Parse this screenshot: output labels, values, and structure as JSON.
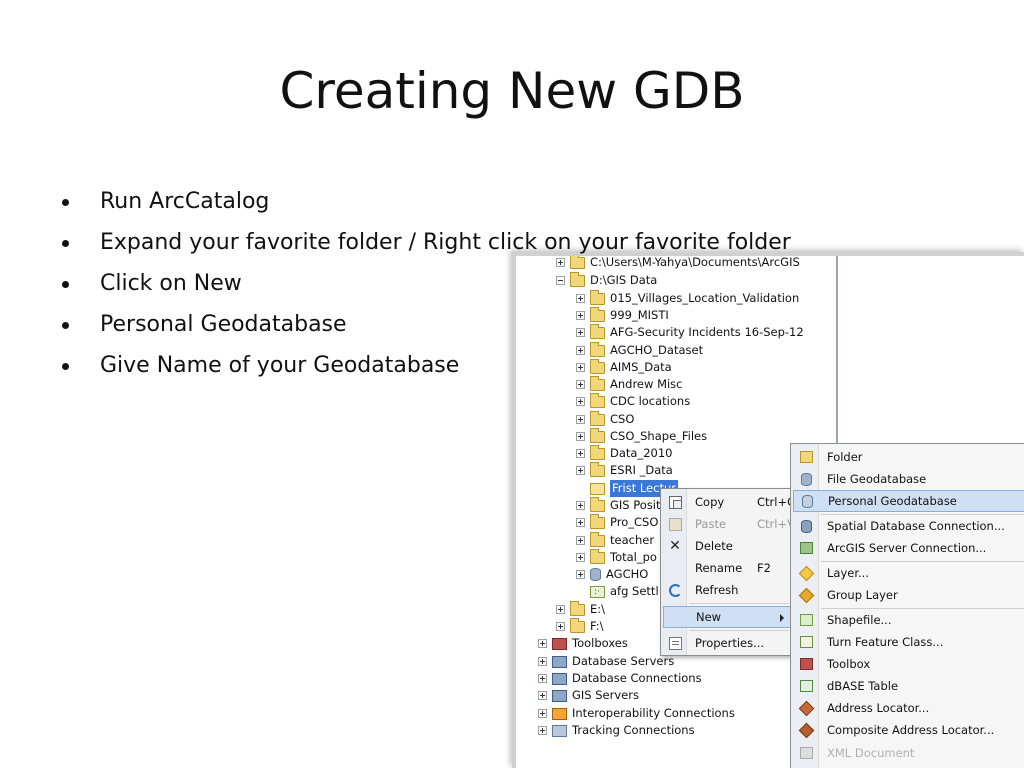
{
  "slide": {
    "title": "Creating New GDB",
    "bullets": [
      "Run ArcCatalog",
      "Expand your favorite folder / Right click on your favorite folder",
      "Click on New",
      "Personal Geodatabase",
      "Give Name of your Geodatabase"
    ]
  },
  "tree": {
    "items": [
      {
        "label": "C:\\Users\\M-Yahya\\Documents\\ArcGIS"
      },
      {
        "label": "D:\\GIS Data"
      },
      {
        "label": "015_Villages_Location_Validation"
      },
      {
        "label": "999_MISTI"
      },
      {
        "label": "AFG-Security Incidents 16-Sep-12"
      },
      {
        "label": "AGCHO_Dataset"
      },
      {
        "label": "AIMS_Data"
      },
      {
        "label": "Andrew Misc"
      },
      {
        "label": "CDC locations"
      },
      {
        "label": "CSO"
      },
      {
        "label": "CSO_Shape_Files"
      },
      {
        "label": "Data_2010"
      },
      {
        "label": "ESRI _Data"
      },
      {
        "label": "Frist Lectur"
      },
      {
        "label": "GIS Posit"
      },
      {
        "label": "Pro_CSO"
      },
      {
        "label": "teacher"
      },
      {
        "label": "Total_po"
      },
      {
        "label": "AGCHO"
      },
      {
        "label": "afg Settl"
      },
      {
        "label": "E:\\"
      },
      {
        "label": "F:\\"
      },
      {
        "label": "Toolboxes"
      },
      {
        "label": "Database Servers"
      },
      {
        "label": "Database Connections"
      },
      {
        "label": "GIS Servers"
      },
      {
        "label": "Interoperability Connections"
      },
      {
        "label": "Tracking Connections"
      }
    ]
  },
  "context_menu": {
    "items": [
      {
        "label": "Copy",
        "shortcut": "Ctrl+C",
        "icon": "copy-icon"
      },
      {
        "label": "Paste",
        "shortcut": "Ctrl+V",
        "icon": "paste-icon"
      },
      {
        "label": "Delete",
        "shortcut": "",
        "icon": "delete-icon"
      },
      {
        "label": "Rename",
        "shortcut": "F2",
        "icon": ""
      },
      {
        "label": "Refresh",
        "shortcut": "",
        "icon": "refresh-icon"
      },
      {
        "label": "New",
        "shortcut": "",
        "icon": ""
      },
      {
        "label": "Properties...",
        "shortcut": "",
        "icon": "properties-icon"
      }
    ]
  },
  "new_submenu": {
    "items": [
      {
        "label": "Folder"
      },
      {
        "label": "File Geodatabase"
      },
      {
        "label": "Personal Geodatabase"
      },
      {
        "label": "Spatial Database Connection..."
      },
      {
        "label": "ArcGIS Server Connection..."
      },
      {
        "label": "Layer..."
      },
      {
        "label": "Group Layer"
      },
      {
        "label": "Shapefile..."
      },
      {
        "label": "Turn Feature Class..."
      },
      {
        "label": "Toolbox"
      },
      {
        "label": "dBASE Table"
      },
      {
        "label": "Address Locator..."
      },
      {
        "label": "Composite Address Locator..."
      },
      {
        "label": "XML Document"
      }
    ]
  }
}
